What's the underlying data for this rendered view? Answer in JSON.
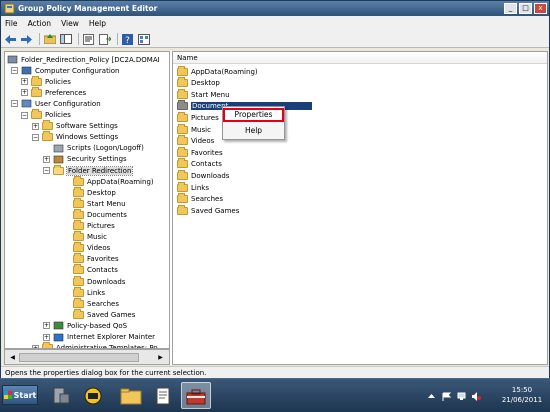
{
  "window": {
    "title": "Group Policy Management Editor"
  },
  "menu": [
    "File",
    "Action",
    "View",
    "Help"
  ],
  "tree": [
    {
      "label": "Folder_Redirection_Policy [DC2A.DOMAI",
      "icon": "policy-icon",
      "exp": "",
      "indent": 0
    },
    {
      "label": "Computer Configuration",
      "icon": "computer-icon",
      "exp": "−",
      "indent": 1
    },
    {
      "label": "Policies",
      "icon": "folder-icon",
      "exp": "+",
      "indent": 2
    },
    {
      "label": "Preferences",
      "icon": "folder-icon",
      "exp": "+",
      "indent": 2
    },
    {
      "label": "User Configuration",
      "icon": "user-icon",
      "exp": "−",
      "indent": 1
    },
    {
      "label": "Policies",
      "icon": "folder-icon",
      "exp": "−",
      "indent": 2
    },
    {
      "label": "Software Settings",
      "icon": "folder-icon",
      "exp": "+",
      "indent": 3
    },
    {
      "label": "Windows Settings",
      "icon": "folder-icon",
      "exp": "−",
      "indent": 3
    },
    {
      "label": "Scripts (Logon/Logoff)",
      "icon": "scripts-icon",
      "exp": "",
      "indent": 4
    },
    {
      "label": "Security Settings",
      "icon": "security-icon",
      "exp": "+",
      "indent": 4
    },
    {
      "label": "Folder Redirection",
      "icon": "folder-open-icon",
      "exp": "−",
      "indent": 4
    },
    {
      "label": "AppData(Roaming)",
      "icon": "folder-icon",
      "exp": "",
      "indent": 5
    },
    {
      "label": "Desktop",
      "icon": "folder-icon",
      "exp": "",
      "indent": 5
    },
    {
      "label": "Start Menu",
      "icon": "folder-icon",
      "exp": "",
      "indent": 5
    },
    {
      "label": "Documents",
      "icon": "folder-icon",
      "exp": "",
      "indent": 5
    },
    {
      "label": "Pictures",
      "icon": "folder-icon",
      "exp": "",
      "indent": 5
    },
    {
      "label": "Music",
      "icon": "folder-icon",
      "exp": "",
      "indent": 5
    },
    {
      "label": "Videos",
      "icon": "folder-icon",
      "exp": "",
      "indent": 5
    },
    {
      "label": "Favorites",
      "icon": "folder-icon",
      "exp": "",
      "indent": 5
    },
    {
      "label": "Contacts",
      "icon": "folder-icon",
      "exp": "",
      "indent": 5
    },
    {
      "label": "Downloads",
      "icon": "folder-icon",
      "exp": "",
      "indent": 5
    },
    {
      "label": "Links",
      "icon": "folder-icon",
      "exp": "",
      "indent": 5
    },
    {
      "label": "Searches",
      "icon": "folder-icon",
      "exp": "",
      "indent": 5
    },
    {
      "label": "Saved Games",
      "icon": "folder-icon",
      "exp": "",
      "indent": 5
    },
    {
      "label": "Policy-based QoS",
      "icon": "chart-icon",
      "exp": "+",
      "indent": 4
    },
    {
      "label": "Internet Explorer Mainter",
      "icon": "ie-icon",
      "exp": "+",
      "indent": 4
    },
    {
      "label": "Administrative Templates: Po",
      "icon": "folder-icon",
      "exp": "+",
      "indent": 3
    }
  ],
  "list": {
    "column": "Name",
    "items": [
      "AppData(Roaming)",
      "Desktop",
      "Start Menu",
      "Document",
      "Pictures",
      "Music",
      "Videos",
      "Favorites",
      "Contacts",
      "Downloads",
      "Links",
      "Searches",
      "Saved Games"
    ]
  },
  "context_menu": {
    "properties": "Properties",
    "help": "Help"
  },
  "status": "Opens the properties dialog box for the current selection.",
  "taskbar": {
    "start": "Start",
    "time": "15:50",
    "date": "21/06/2011"
  },
  "colors": {
    "selection": "#1c3f7a",
    "highlight_box": "#e0001a"
  }
}
